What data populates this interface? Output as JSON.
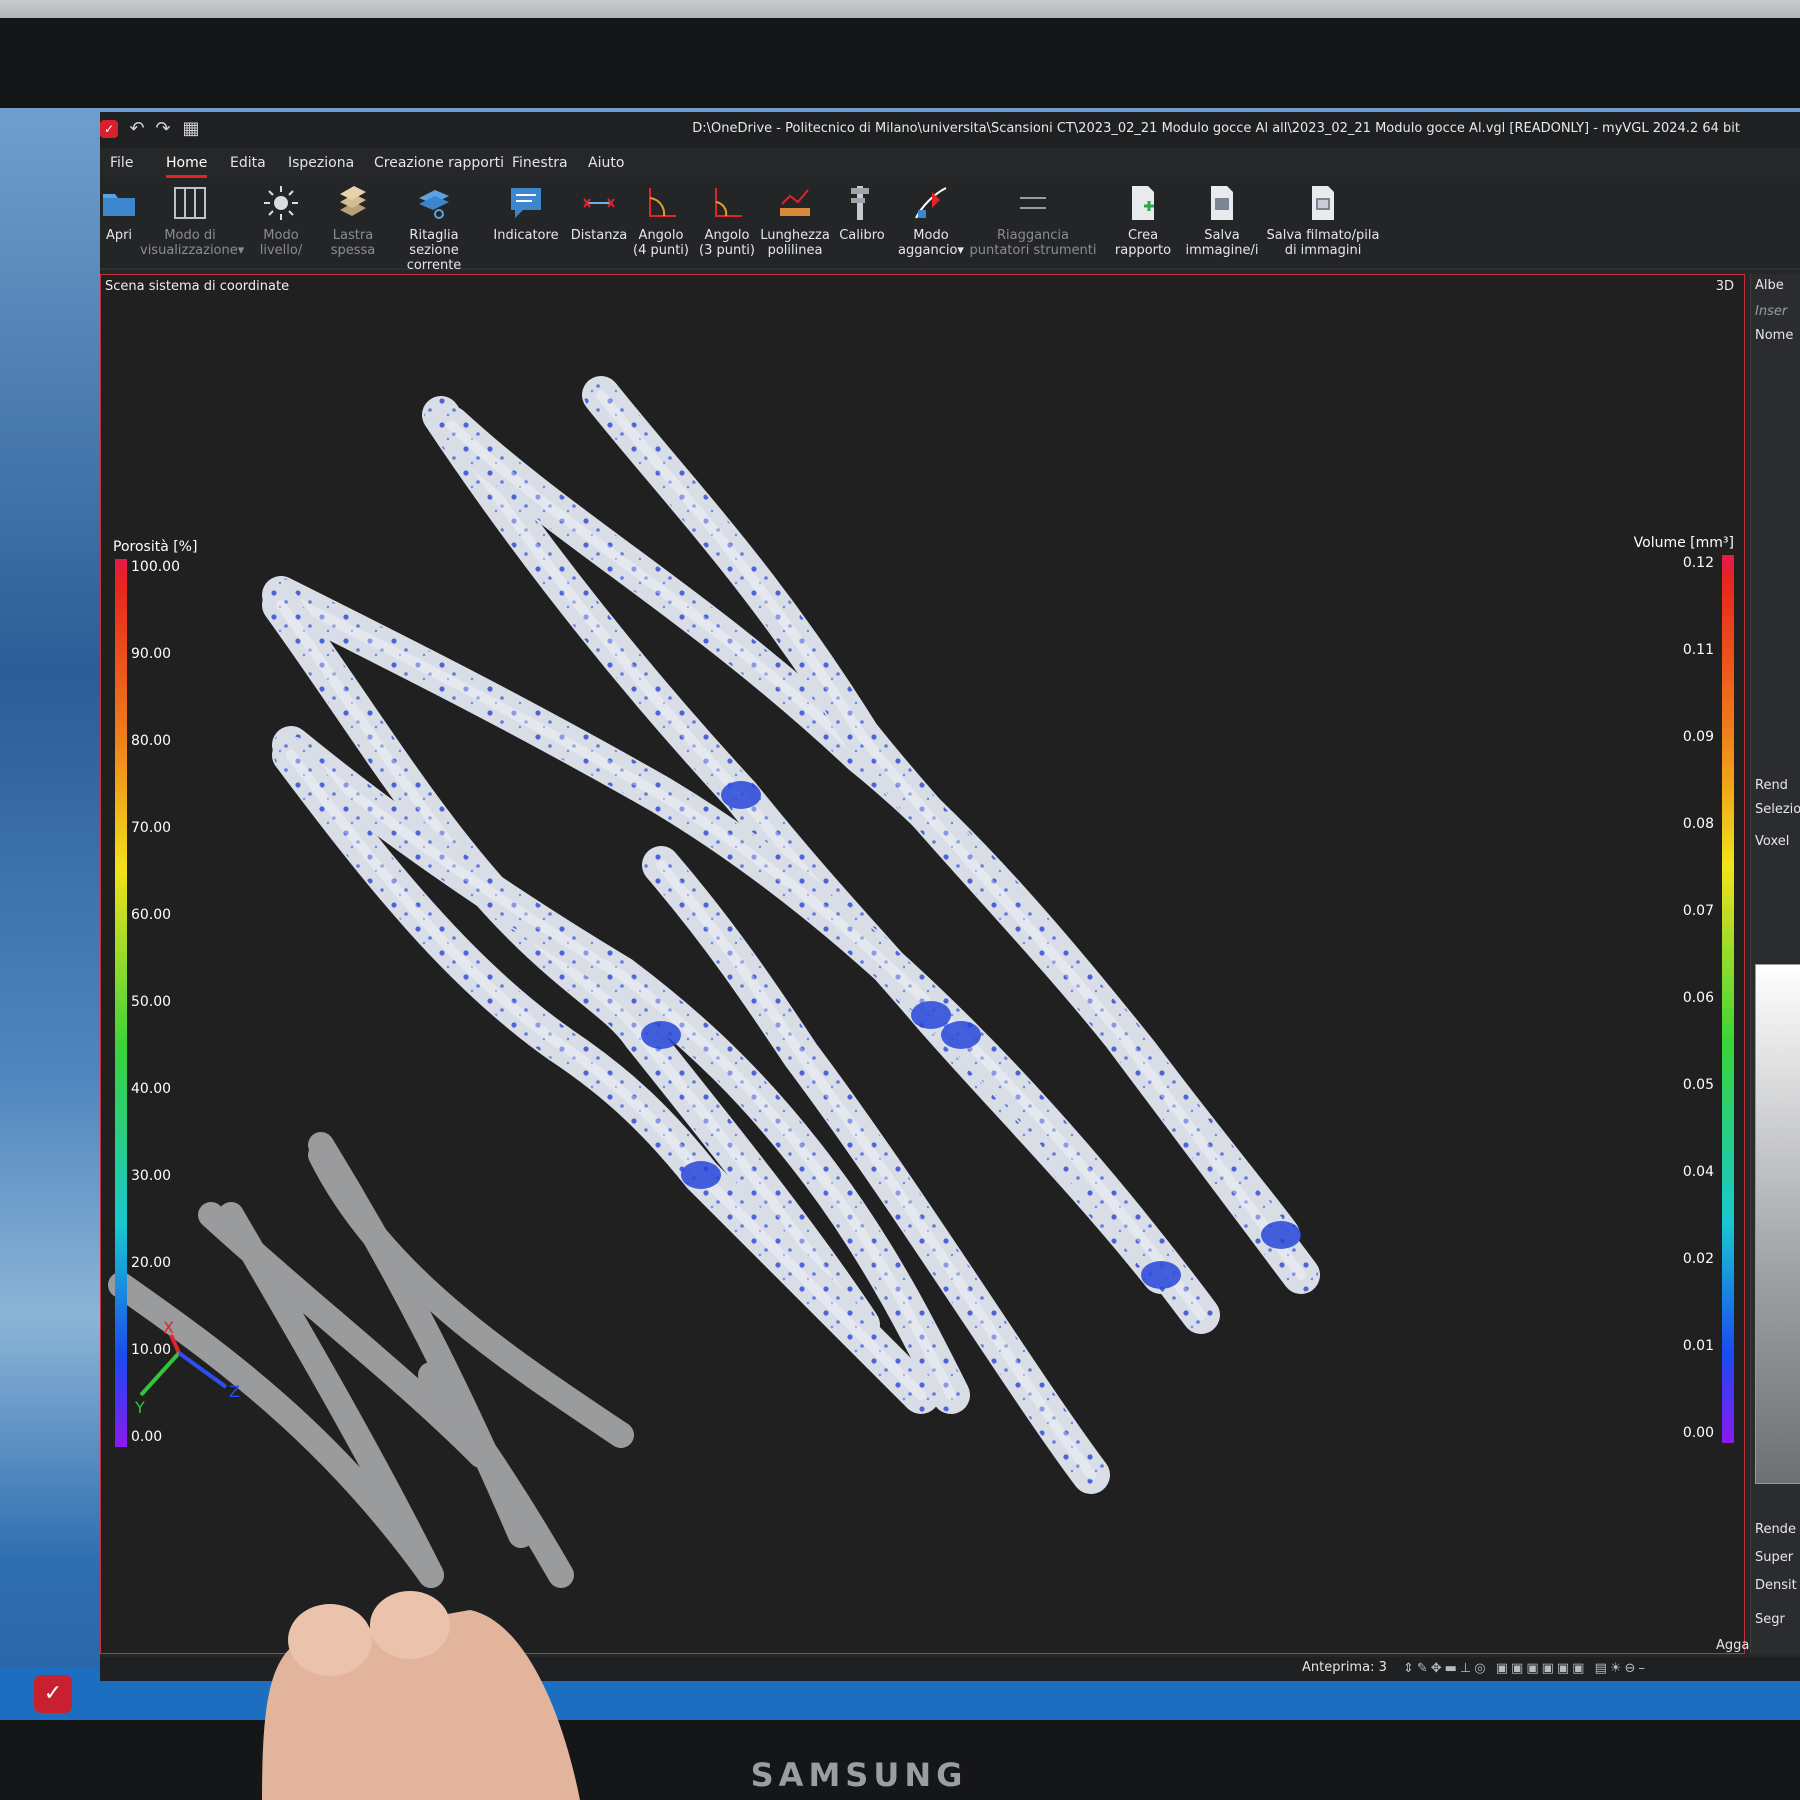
{
  "window": {
    "title": "D:\\OneDrive - Politecnico di Milano\\universita\\Scansioni CT\\2023_02_21 Modulo gocce Al all\\2023_02_21 Modulo gocce Al.vgl [READONLY] - myVGL 2024.2 64 bit"
  },
  "menu": [
    "File",
    "Home",
    "Edita",
    "Ispeziona",
    "Creazione rapporti",
    "Finestra",
    "Aiuto"
  ],
  "menu_active": "Home",
  "ribbon": [
    {
      "label": "Apri",
      "icon": "folder-icon",
      "enabled": true
    },
    {
      "label": "Modo di visualizzazione▾",
      "icon": "layout-icon",
      "enabled": false
    },
    {
      "label": "Modo livello/",
      "icon": "sun-icon",
      "enabled": false
    },
    {
      "label": "Lastra spessa",
      "icon": "slab-icon",
      "enabled": false
    },
    {
      "label": "Ritaglia sezione corrente",
      "icon": "clip-icon",
      "enabled": true
    },
    {
      "label": "Indicatore",
      "icon": "annotation-icon",
      "enabled": true
    },
    {
      "label": "Distanza",
      "icon": "distance-icon",
      "enabled": true
    },
    {
      "label": "Angolo (4 punti)",
      "icon": "angle4-icon",
      "enabled": true
    },
    {
      "label": "Angolo (3 punti)",
      "icon": "angle3-icon",
      "enabled": true
    },
    {
      "label": "Lunghezza polilinea",
      "icon": "polyline-icon",
      "enabled": true
    },
    {
      "label": "Calibro",
      "icon": "caliper-icon",
      "enabled": true
    },
    {
      "label": "Modo aggancio▾",
      "icon": "snap-icon",
      "enabled": true
    },
    {
      "label": "Riaggancia puntatori strumenti",
      "icon": "resnap-icon",
      "enabled": false
    },
    {
      "label": "Crea rapporto",
      "icon": "report-icon",
      "enabled": true
    },
    {
      "label": "Salva immagine/i",
      "icon": "image-icon",
      "enabled": true
    },
    {
      "label": "Salva filmato/pila di immagini",
      "icon": "movie-icon",
      "enabled": true
    }
  ],
  "viewport": {
    "scene_label": "Scena sistema di coordinate",
    "mode": "3D",
    "porosity_scale": {
      "title": "Porosità [%]",
      "ticks": [
        "100.00",
        "90.00",
        "80.00",
        "70.00",
        "60.00",
        "50.00",
        "40.00",
        "30.00",
        "20.00",
        "10.00",
        "0.00"
      ]
    },
    "volume_scale": {
      "title": "Volume [mm³]",
      "ticks": [
        "0.12",
        "0.11",
        "0.09",
        "0.08",
        "0.07",
        "0.06",
        "0.05",
        "0.04",
        "0.02",
        "0.01",
        "0.00"
      ]
    },
    "axes": [
      "X",
      "Y",
      "Z"
    ]
  },
  "statusbar": {
    "preview_label": "Anteprima: 3",
    "snap_label": "Aggancio: Su"
  },
  "right_panel": [
    "Albe",
    "Inser",
    "Nome",
    "Rend",
    "Selezio",
    "Voxel",
    "Rende",
    "Super",
    "Densit",
    "Segr"
  ],
  "monitor_brand": "SAMSUNG",
  "colors": {
    "accent": "#e0242c",
    "defect": "#2846d8",
    "part": "#d8dde6"
  }
}
